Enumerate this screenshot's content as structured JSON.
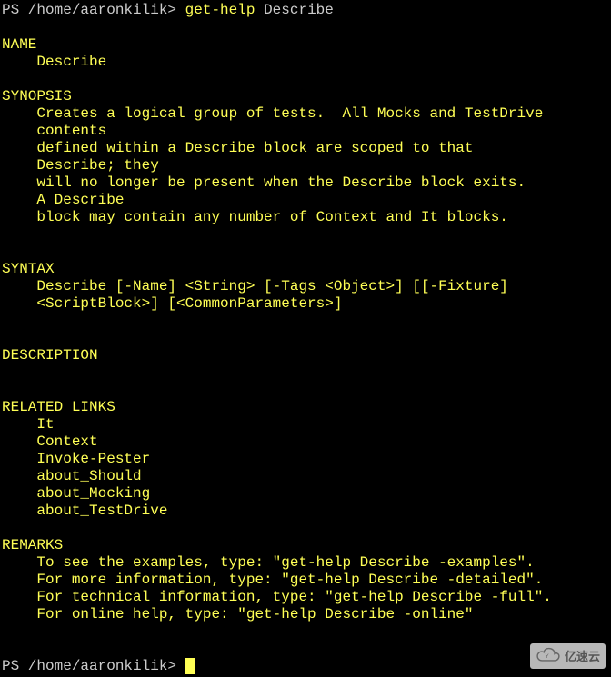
{
  "prompt1_prefix": "PS /home/aaronkilik> ",
  "command_part1": "get-help ",
  "command_part2": "Describe",
  "blank": "",
  "name_header": "NAME",
  "name_value": "    Describe",
  "synopsis_header": "SYNOPSIS",
  "synopsis_l1": "    Creates a logical group of tests.  All Mocks and TestDrive ",
  "synopsis_l2": "    contents",
  "synopsis_l3": "    defined within a Describe block are scoped to that ",
  "synopsis_l4": "    Describe; they",
  "synopsis_l5": "    will no longer be present when the Describe block exits.  ",
  "synopsis_l6": "    A Describe",
  "synopsis_l7": "    block may contain any number of Context and It blocks.",
  "syntax_header": "SYNTAX",
  "syntax_l1": "    Describe [-Name] <String> [-Tags <Object>] [[-Fixture] ",
  "syntax_l2": "    <ScriptBlock>] [<CommonParameters>]",
  "description_header": "DESCRIPTION",
  "related_header": "RELATED LINKS",
  "related_l1": "    It",
  "related_l2": "    Context",
  "related_l3": "    Invoke-Pester",
  "related_l4": "    about_Should",
  "related_l5": "    about_Mocking",
  "related_l6": "    about_TestDrive",
  "remarks_header": "REMARKS",
  "remarks_l1": "    To see the examples, type: \"get-help Describe -examples\".",
  "remarks_l2": "    For more information, type: \"get-help Describe -detailed\".",
  "remarks_l3": "    For technical information, type: \"get-help Describe -full\".",
  "remarks_l4": "    For online help, type: \"get-help Describe -online\"",
  "prompt2_prefix": "PS /home/aaronkilik> ",
  "watermark_text": "亿速云"
}
